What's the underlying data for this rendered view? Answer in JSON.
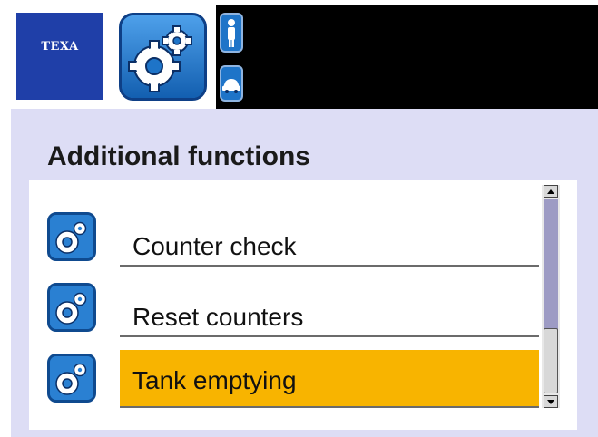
{
  "header": {
    "logo_text": "TEXA",
    "main_icon": "gears-icon",
    "side_buttons": [
      {
        "icon": "person-icon"
      },
      {
        "icon": "car-icon"
      }
    ]
  },
  "page": {
    "title": "Additional functions"
  },
  "menu": {
    "items": [
      {
        "label": "Counter check",
        "icon": "gears-icon",
        "selected": false
      },
      {
        "label": "Reset counters",
        "icon": "gears-icon",
        "selected": false
      },
      {
        "label": "Tank emptying",
        "icon": "gears-icon",
        "selected": true
      }
    ]
  },
  "scrollbar": {
    "position": "bottom"
  },
  "colors": {
    "background": "#ddddf5",
    "brand_blue": "#1f3fa8",
    "icon_blue": "#1e74c8",
    "selection": "#f8b400",
    "top_bar": "#000000"
  }
}
